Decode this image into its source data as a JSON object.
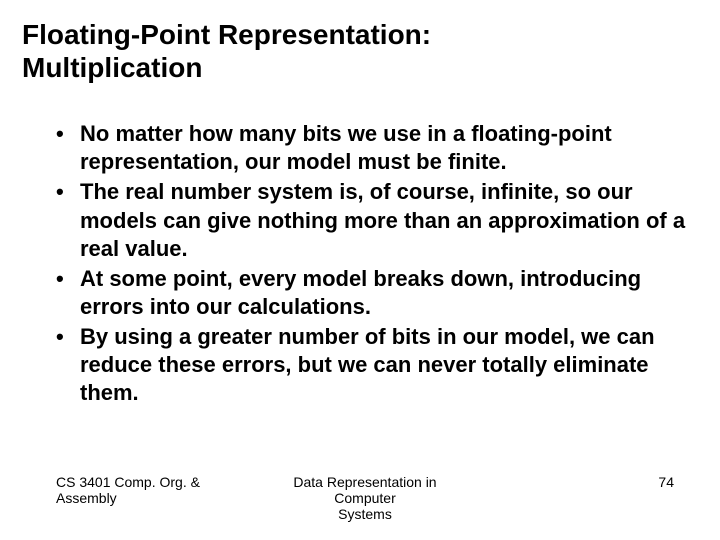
{
  "title_line1": "Floating-Point Representation:",
  "title_line2": "Multiplication",
  "bullets": [
    "No matter how many bits we use in a floating-point representation, our model must be finite.",
    "The real number system is, of course, infinite, so our models can give nothing more than an approximation of a real value.",
    "At some point, every model breaks down, introducing errors into our calculations.",
    "By using a greater number of bits in our model, we can reduce these errors, but we can never totally eliminate them."
  ],
  "footer": {
    "left": "CS 3401 Comp. Org. & Assembly",
    "center_line1": "Data Representation in Computer",
    "center_line2": "Systems",
    "right": "74"
  }
}
